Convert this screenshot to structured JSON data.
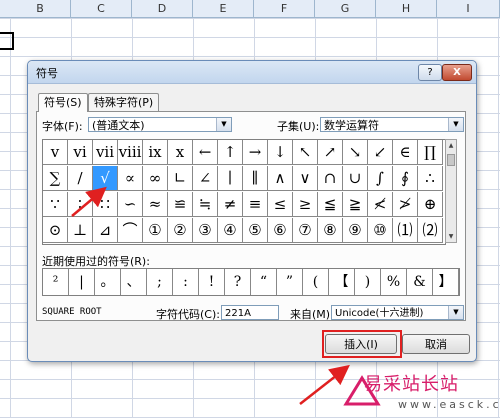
{
  "columns": [
    "B",
    "C",
    "D",
    "E",
    "F",
    "G",
    "H",
    "I"
  ],
  "dialog": {
    "title": "符号",
    "help_label": "?",
    "close_label": "X",
    "tabs": [
      "符号(S)",
      "特殊字符(P)"
    ],
    "font_label": "字体(F):",
    "font_value": "(普通文本)",
    "subset_label": "子集(U):",
    "subset_value": "数学运算符",
    "grid_symbols": [
      [
        "v",
        "vi",
        "vii",
        "viii",
        "ix",
        "x",
        "←",
        "↑",
        "→",
        "↓",
        "↖",
        "↗",
        "↘",
        "↙",
        "∈",
        "∏"
      ],
      [
        "∑",
        "/",
        "√",
        "∝",
        "∞",
        "∟",
        "∠",
        "∣",
        "∥",
        "∧",
        "∨",
        "∩",
        "∪",
        "∫",
        "∮",
        "∴"
      ],
      [
        "∵",
        "∶",
        "∷",
        "∽",
        "≈",
        "≌",
        "≒",
        "≠",
        "≡",
        "≤",
        "≥",
        "≦",
        "≧",
        "≮",
        "≯",
        "⊕"
      ],
      [
        "⊙",
        "⊥",
        "⊿",
        "⌒",
        "①",
        "②",
        "③",
        "④",
        "⑤",
        "⑥",
        "⑦",
        "⑧",
        "⑨",
        "⑩",
        "⑴",
        "⑵"
      ]
    ],
    "selected_symbol": "√",
    "recent_label": "近期使用过的符号(R):",
    "recent_symbols": [
      "²",
      "|",
      "。",
      "、",
      ";",
      ":",
      "!",
      "?",
      "“",
      "”",
      "(",
      "【",
      ")",
      "%",
      "&",
      "】"
    ],
    "symbol_name": "SQUARE ROOT",
    "char_code_label": "字符代码(C):",
    "char_code_value": "221A",
    "from_label": "来自(M):",
    "from_value": "Unicode(十六进制)",
    "insert_label": "插入(I)",
    "cancel_label": "取消"
  },
  "watermark": {
    "main": "易采站长站",
    "url": "www.easck.com"
  },
  "colors": {
    "selection": "#3399ff",
    "highlight": "#e02020",
    "watermark": "#d81e6a"
  }
}
